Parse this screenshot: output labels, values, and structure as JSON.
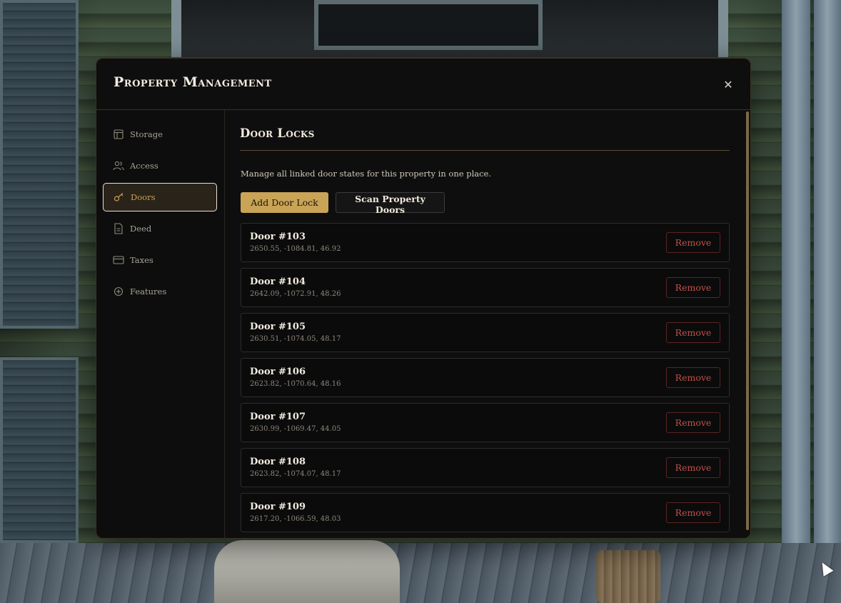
{
  "modal": {
    "title": "Property Management",
    "close_symbol": "✕"
  },
  "sidebar": {
    "items": [
      {
        "label": "Storage",
        "icon": "storage-icon",
        "active": false
      },
      {
        "label": "Access",
        "icon": "users-icon",
        "active": false
      },
      {
        "label": "Doors",
        "icon": "key-icon",
        "active": true
      },
      {
        "label": "Deed",
        "icon": "document-icon",
        "active": false
      },
      {
        "label": "Taxes",
        "icon": "credit-card-icon",
        "active": false
      },
      {
        "label": "Features",
        "icon": "features-icon",
        "active": false
      }
    ]
  },
  "main": {
    "section_title": "Door Locks",
    "description": "Manage all linked door states for this property in one place.",
    "add_button_label": "Add Door Lock",
    "scan_button_label": "Scan Property Doors",
    "doors": [
      {
        "name": "Door #103",
        "coords": "2650.55, -1084.81, 46.92",
        "action": "Remove"
      },
      {
        "name": "Door #104",
        "coords": "2642.09, -1072.91, 48.26",
        "action": "Remove"
      },
      {
        "name": "Door #105",
        "coords": "2630.51, -1074.05, 48.17",
        "action": "Remove"
      },
      {
        "name": "Door #106",
        "coords": "2623.82, -1070.64, 48.16",
        "action": "Remove"
      },
      {
        "name": "Door #107",
        "coords": "2630.99, -1069.47, 44.05",
        "action": "Remove"
      },
      {
        "name": "Door #108",
        "coords": "2623.82, -1074.07, 48.17",
        "action": "Remove"
      },
      {
        "name": "Door #109",
        "coords": "2617.20, -1066.59, 48.03",
        "action": "Remove"
      }
    ]
  },
  "colors": {
    "accent_gold": "#c9a356",
    "danger_red": "#c0504a",
    "panel_bg": "#0e0e0e"
  }
}
